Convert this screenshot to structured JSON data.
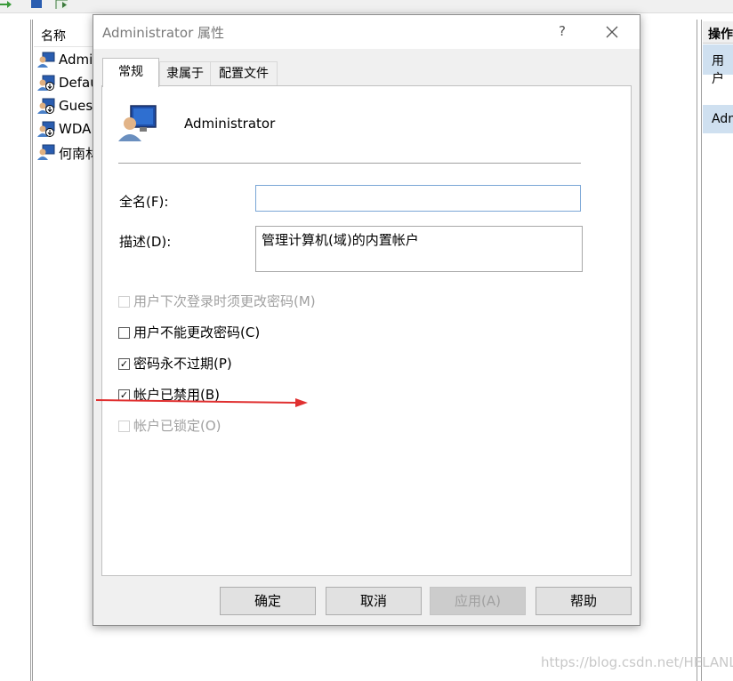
{
  "background": {
    "list_header": "名称",
    "users": [
      {
        "label": "Admi",
        "icon": "user-monitor-icon"
      },
      {
        "label": "Defau",
        "icon": "user-disabled-icon"
      },
      {
        "label": "Guest",
        "icon": "user-disabled-icon"
      },
      {
        "label": "WDA",
        "icon": "user-disabled-icon"
      },
      {
        "label": "何南林",
        "icon": "user-monitor-icon"
      }
    ],
    "actions_header": "操作",
    "actions_item1": "用户",
    "actions_item2": "Adm",
    "watermark": "https://blog.csdn.net/HELANL"
  },
  "dialog": {
    "title": "Administrator 属性",
    "help_glyph": "?",
    "tabs": [
      "常规",
      "隶属于",
      "配置文件"
    ],
    "user_name": "Administrator",
    "fullname_label": "全名(F):",
    "fullname_value": "",
    "desc_label": "描述(D):",
    "desc_value": "管理计算机(域)的内置帐户",
    "checkboxes": [
      {
        "label": "用户下次登录时须更改密码(M)",
        "checked": false,
        "disabled": true
      },
      {
        "label": "用户不能更改密码(C)",
        "checked": false,
        "disabled": false
      },
      {
        "label": "密码永不过期(P)",
        "checked": true,
        "disabled": false
      },
      {
        "label": "帐户已禁用(B)",
        "checked": true,
        "disabled": false
      },
      {
        "label": "帐户已锁定(O)",
        "checked": false,
        "disabled": true
      }
    ],
    "buttons": {
      "ok": "确定",
      "cancel": "取消",
      "apply": "应用(A)",
      "help": "帮助"
    }
  },
  "annotation": {
    "arrow_color": "#e03030"
  },
  "colors": {
    "selection": "#cfe0f0",
    "input_focus_border": "#7aa6d6"
  }
}
